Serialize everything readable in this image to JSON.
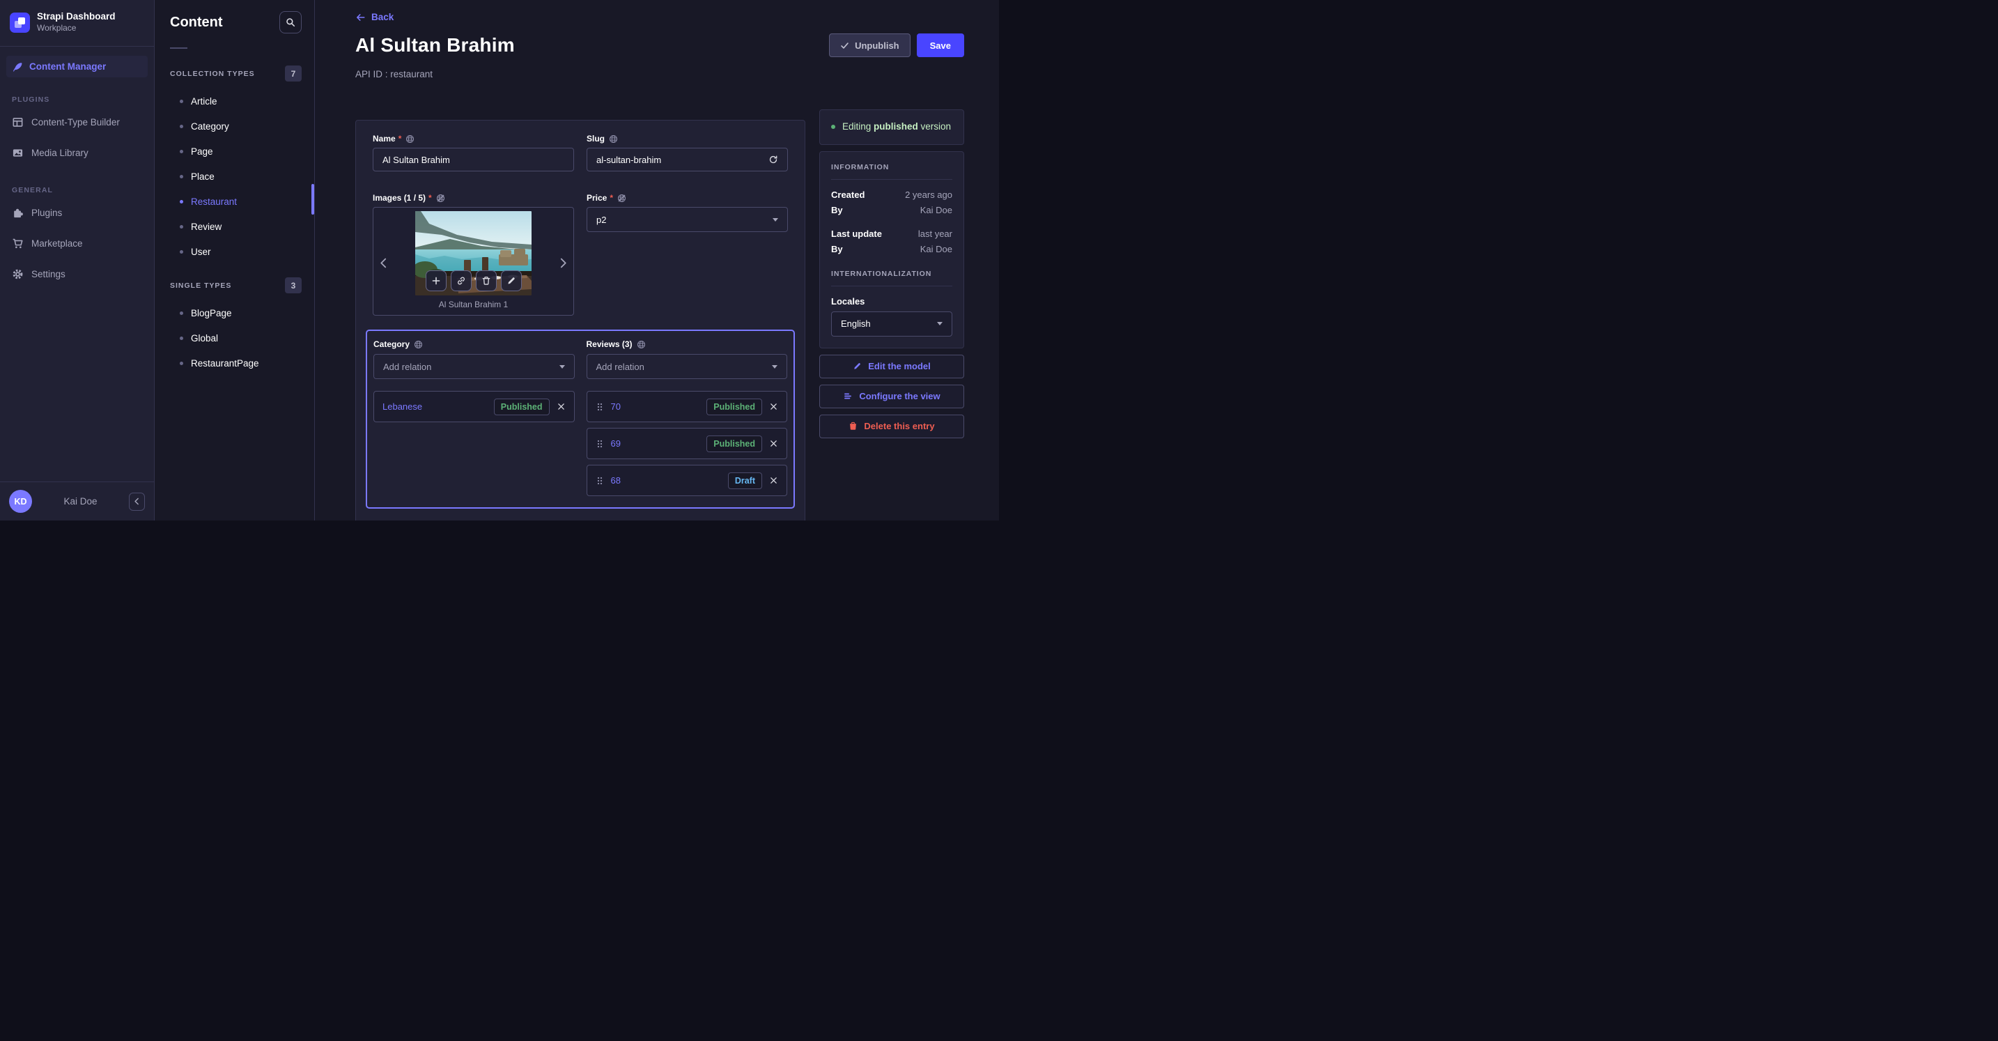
{
  "brand": {
    "app_title": "Strapi Dashboard",
    "workspace": "Workplace"
  },
  "leftnav": {
    "content_manager": "Content Manager",
    "plugins_section": "PLUGINS",
    "general_section": "GENERAL",
    "items": {
      "ctb": "Content-Type Builder",
      "media": "Media Library",
      "plugins": "Plugins",
      "marketplace": "Marketplace",
      "settings": "Settings"
    },
    "user": {
      "initials": "KD",
      "name": "Kai Doe"
    }
  },
  "subnav": {
    "title": "Content",
    "collection_types": {
      "label": "COLLECTION TYPES",
      "count": "7",
      "items": [
        "Article",
        "Category",
        "Page",
        "Place",
        "Restaurant",
        "Review",
        "User"
      ]
    },
    "single_types": {
      "label": "SINGLE TYPES",
      "count": "3",
      "items": [
        "BlogPage",
        "Global",
        "RestaurantPage"
      ]
    }
  },
  "header": {
    "back": "Back",
    "title": "Al Sultan Brahim",
    "api_id": "API ID : restaurant",
    "unpublish": "Unpublish",
    "save": "Save"
  },
  "form": {
    "name": {
      "label": "Name",
      "required": "*",
      "value": "Al Sultan Brahim"
    },
    "slug": {
      "label": "Slug",
      "value": "al-sultan-brahim"
    },
    "images": {
      "label": "Images (1 / 5)",
      "required": "*",
      "caption": "Al Sultan Brahim 1"
    },
    "price": {
      "label": "Price",
      "required": "*",
      "value": "p2"
    },
    "category": {
      "label": "Category",
      "placeholder": "Add relation",
      "relation": {
        "name": "Lebanese",
        "status": "Published"
      }
    },
    "reviews": {
      "label": "Reviews (3)",
      "placeholder": "Add relation",
      "rows": [
        {
          "id": "70",
          "status": "Published"
        },
        {
          "id": "69",
          "status": "Published"
        },
        {
          "id": "68",
          "status": "Draft"
        }
      ]
    },
    "information_label": "Information"
  },
  "panel": {
    "status": {
      "prefix": "Editing ",
      "bold": "published",
      "suffix": " version"
    },
    "information": {
      "label": "INFORMATION",
      "rows": [
        [
          "Created",
          "2 years ago"
        ],
        [
          "By",
          "Kai Doe"
        ],
        [
          "Last update",
          "last year"
        ],
        [
          "By",
          "Kai Doe"
        ]
      ]
    },
    "i18n": {
      "label": "INTERNATIONALIZATION",
      "locales_label": "Locales",
      "locale": "English"
    },
    "actions": {
      "edit_model": "Edit the model",
      "configure_view": "Configure the view",
      "delete_entry": "Delete this entry"
    }
  },
  "colors": {
    "primary": "#4945ff",
    "primary_light": "#7b79ff",
    "success": "#5cb176",
    "danger": "#ee5e52",
    "draft_blue": "#66b7f1",
    "background": "#181826",
    "surface": "#212134"
  }
}
